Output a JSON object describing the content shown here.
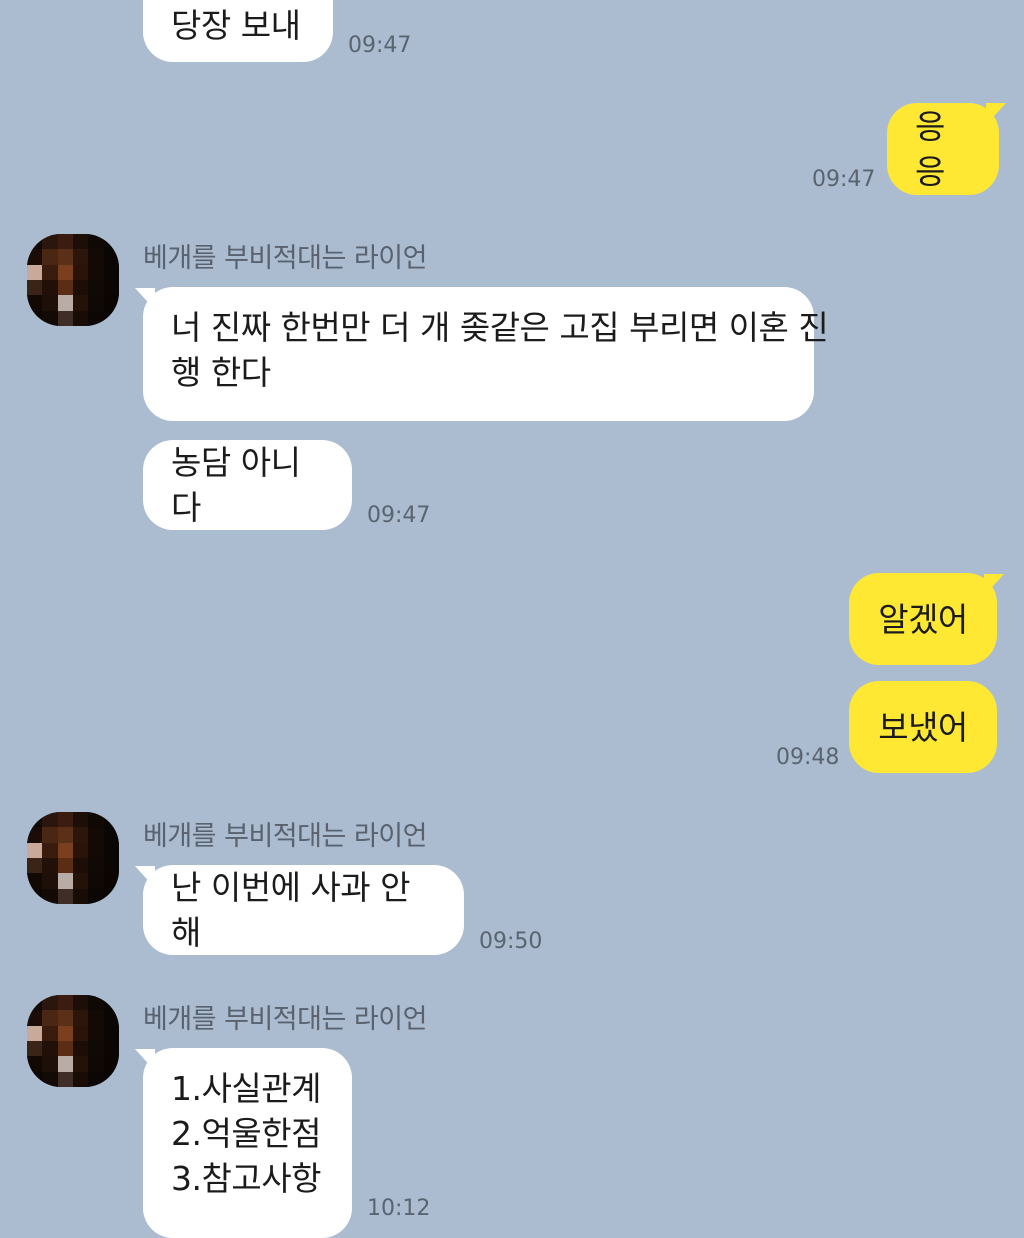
{
  "contact": {
    "name": "베개를 부비적대는 라이언"
  },
  "messages": {
    "m0": {
      "text": "당장 보내",
      "time": "09:47"
    },
    "m1": {
      "text": "응응",
      "time": "09:47"
    },
    "m2": {
      "text_line1": "너 진짜 한번만 더 개 좆같은 고집 부리면 이혼 진",
      "text_line2": "행 한다"
    },
    "m3": {
      "text": "농담 아니다",
      "time": "09:47"
    },
    "m4": {
      "text": "알겠어"
    },
    "m5": {
      "text": "보냈어",
      "time": "09:48"
    },
    "m6": {
      "text": "난 이번에 사과 안해",
      "time": "09:50"
    },
    "m7": {
      "line1": "1.사실관계",
      "line2": "2.억울한점",
      "line3": "3.참고사항",
      "time": "10:12"
    }
  },
  "colors": {
    "background": "#abbcd1",
    "incoming_bubble": "#ffffff",
    "outgoing_bubble": "#fee833",
    "timestamp": "#5a6470",
    "sender_name": "#59626e"
  },
  "avatar": {
    "style": "pixelated-mosaic"
  }
}
